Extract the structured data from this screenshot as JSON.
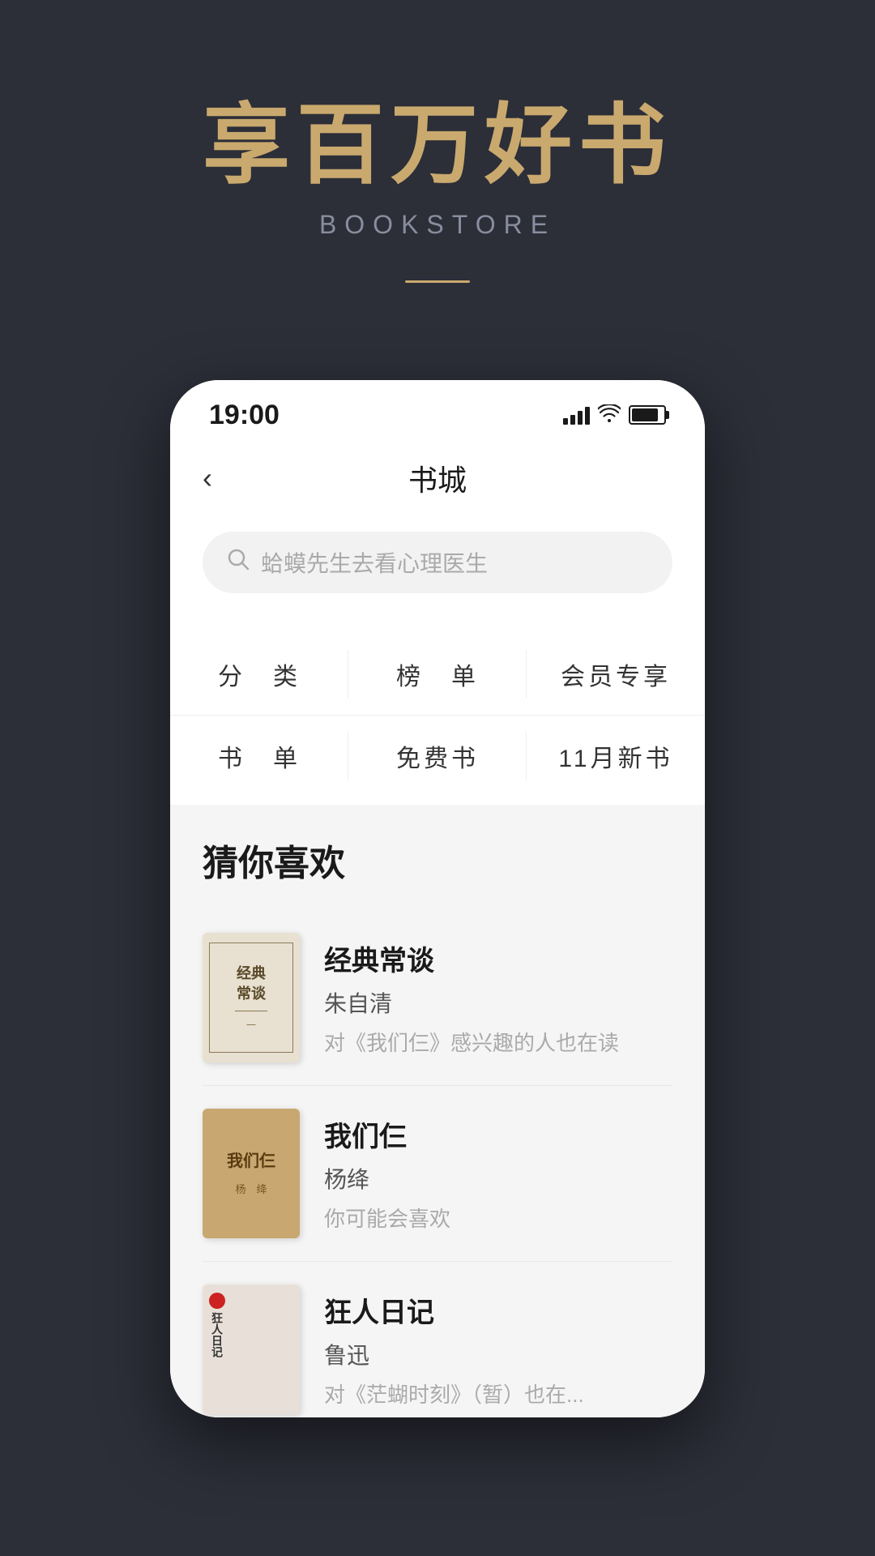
{
  "hero": {
    "title": "享百万好书",
    "subtitle": "BOOKSTORE",
    "divider": true
  },
  "phone": {
    "statusBar": {
      "time": "19:00"
    },
    "navBar": {
      "back": "‹",
      "title": "书城"
    },
    "search": {
      "placeholder": "蛤蟆先生去看心理医生"
    },
    "categories": [
      [
        {
          "label": "分　类"
        },
        {
          "label": "榜　单"
        },
        {
          "label": "会员专享"
        }
      ],
      [
        {
          "label": "书　单"
        },
        {
          "label": "免费书"
        },
        {
          "label": "11月新书"
        }
      ]
    ],
    "recommend": {
      "title": "猜你喜欢",
      "books": [
        {
          "id": 1,
          "name": "经典常谈",
          "author": "朱自清",
          "desc": "对《我们仨》感兴趣的人也在读",
          "coverText": "经典常谈"
        },
        {
          "id": 2,
          "name": "我们仨",
          "author": "杨绛",
          "desc": "你可能会喜欢",
          "coverText": "我们仨"
        },
        {
          "id": 3,
          "name": "狂人日记",
          "author": "鲁迅",
          "desc": "对《茫蝴时刻》（暂）也在...",
          "coverText": "狂人日记"
        }
      ]
    }
  }
}
